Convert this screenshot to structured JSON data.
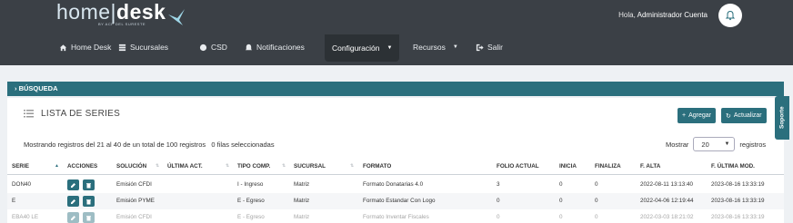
{
  "header": {
    "logo_light": "home",
    "logo_bold": "desk",
    "logo_sub": "BY ACP DEL SURESTE",
    "greeting_prefix": "Hola,",
    "user_name": "Administrador Cuenta"
  },
  "nav": {
    "items": [
      {
        "label": "Home Desk",
        "icon": "home-icon"
      },
      {
        "label": "Sucursales",
        "icon": "grid-icon"
      },
      {
        "label": "CSD",
        "icon": "circle-icon"
      },
      {
        "label": "Notificaciones",
        "icon": "bell-icon"
      },
      {
        "label": "Configuración",
        "icon": "caret-down-icon"
      },
      {
        "label": "Recursos",
        "icon": "caret-down-icon"
      },
      {
        "label": "Salir",
        "icon": "logout-icon"
      }
    ]
  },
  "search": {
    "label": "› BÚSQUEDA"
  },
  "list": {
    "title": "LISTA DE SERIES",
    "add_label": "Agregar",
    "update_label": "Actualizar",
    "records_info": "Mostrando registros del 21 al 40 de un total de 100 registros",
    "selected_info": "0 filas seleccionadas",
    "show_label": "Mostrar",
    "show_value": "20",
    "records_label": "registros"
  },
  "table": {
    "columns": [
      "SERIE",
      "ACCIONES",
      "SOLUCIÓN",
      "ÚLTIMA ACT.",
      "TIPO COMP.",
      "SUCURSAL",
      "FORMATO",
      "FOLIO ACTUAL",
      "INICIA",
      "FINALIZA",
      "F. ALTA",
      "F. ÚLTIMA MOD."
    ],
    "rows": [
      {
        "serie": "DON40",
        "solucion": "Emisión CFDI",
        "ultima_act": "",
        "tipo": "I - Ingreso",
        "sucursal": "Matriz",
        "formato": "Formato Donatarias 4.0",
        "folio": "3",
        "inicia": "0",
        "finaliza": "0",
        "alta": "2022-08-11 13:13:40",
        "mod": "2023-08-16 13:33:19"
      },
      {
        "serie": "E",
        "solucion": "Emisión PYME",
        "ultima_act": "",
        "tipo": "E - Egreso",
        "sucursal": "Matriz",
        "formato": "Formato Estandar Con Logo",
        "folio": "0",
        "inicia": "0",
        "finaliza": "0",
        "alta": "2022-04-06 12:19:44",
        "mod": "2023-08-16 13:33:19"
      },
      {
        "serie": "EBA40 LE",
        "solucion": "Emisión CFDI",
        "ultima_act": "",
        "tipo": "E - Egreso",
        "sucursal": "Matriz",
        "formato": "Formato Inventar Fiscales",
        "folio": "0",
        "inicia": "0",
        "finaliza": "0",
        "alta": "2022-03-03 18:21:02",
        "mod": "2023-08-16 13:33:19"
      }
    ]
  },
  "support_tab": {
    "label": "Soporte"
  },
  "colors": {
    "header_bg": "#3b4046",
    "accent": "#2b6f7d",
    "page_bg": "#eef1f4"
  }
}
